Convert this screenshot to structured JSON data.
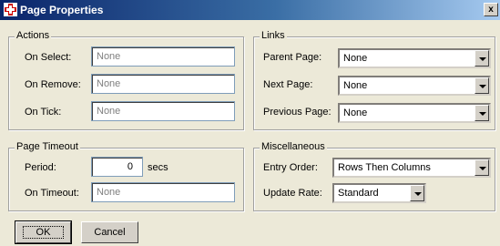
{
  "window": {
    "title": "Page Properties",
    "close_glyph": "x"
  },
  "actions": {
    "legend": "Actions",
    "on_select": {
      "label": "On Select:",
      "value": "None"
    },
    "on_remove": {
      "label": "On Remove:",
      "value": "None"
    },
    "on_tick": {
      "label": "On Tick:",
      "value": "None"
    }
  },
  "links": {
    "legend": "Links",
    "parent_page": {
      "label": "Parent Page:",
      "value": "None"
    },
    "next_page": {
      "label": "Next Page:",
      "value": "None"
    },
    "previous_page": {
      "label": "Previous Page:",
      "value": "None"
    }
  },
  "page_timeout": {
    "legend": "Page Timeout",
    "period": {
      "label": "Period:",
      "value": "0",
      "unit": "secs"
    },
    "on_timeout": {
      "label": "On Timeout:",
      "value": "None"
    }
  },
  "misc": {
    "legend": "Miscellaneous",
    "entry_order": {
      "label": "Entry Order:",
      "value": "Rows Then Columns"
    },
    "update_rate": {
      "label": "Update Rate:",
      "value": "Standard"
    }
  },
  "buttons": {
    "ok": "OK",
    "cancel": "Cancel"
  },
  "icons": {
    "app": "page-properties-icon",
    "close": "close-icon",
    "dropdown": "chevron-down-icon"
  }
}
